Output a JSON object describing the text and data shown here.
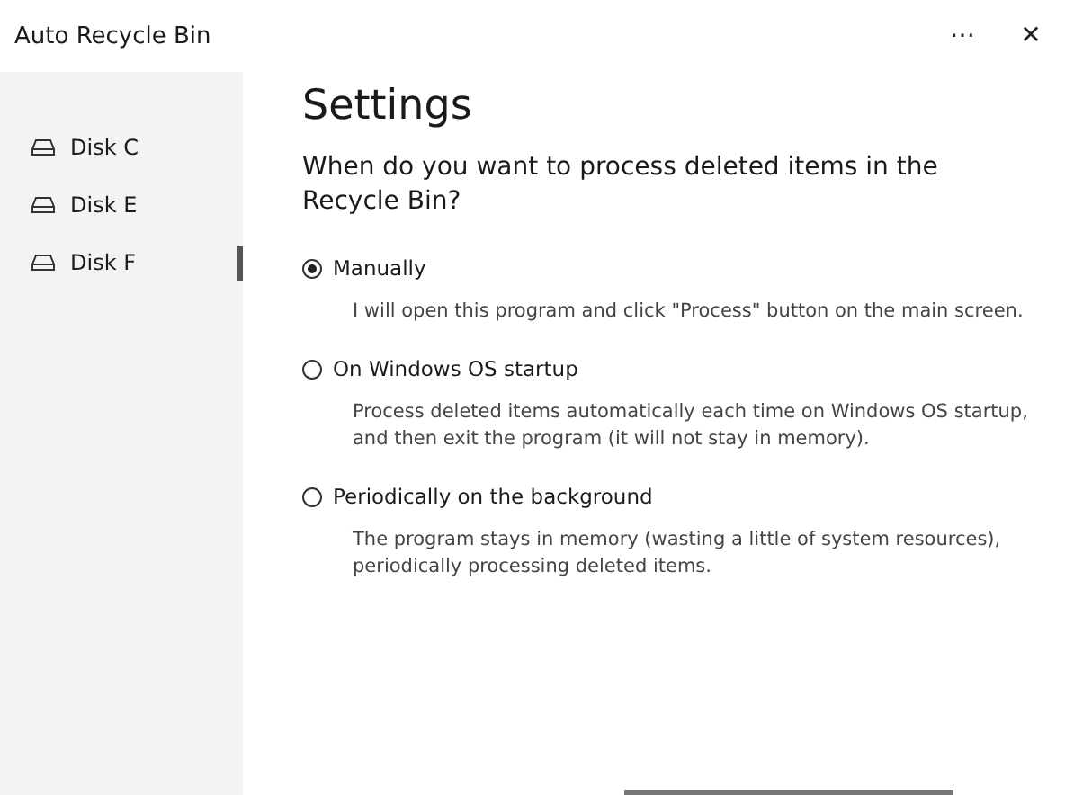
{
  "window": {
    "title": "Auto Recycle Bin",
    "controls": [
      "⋯",
      "✕"
    ]
  },
  "sidebar": {
    "items": [
      {
        "label": "Disk C",
        "selected": false
      },
      {
        "label": "Disk E",
        "selected": false
      },
      {
        "label": "Disk F",
        "selected": true
      }
    ]
  },
  "content": {
    "heading": "Settings",
    "question": "When do you want to process deleted items in the Recycle Bin?",
    "options": [
      {
        "label": "Manually",
        "selected": true,
        "description": "I will open this program and click \"Process\" button on the main screen."
      },
      {
        "label": "On Windows OS startup",
        "selected": false,
        "description": "Process deleted items automatically each time on Windows OS startup, and then exit the program (it will not stay in memory)."
      },
      {
        "label": "Periodically on the background",
        "selected": false,
        "description": "The program stays in memory (wasting a little of system resources), periodically processing deleted items."
      }
    ]
  }
}
